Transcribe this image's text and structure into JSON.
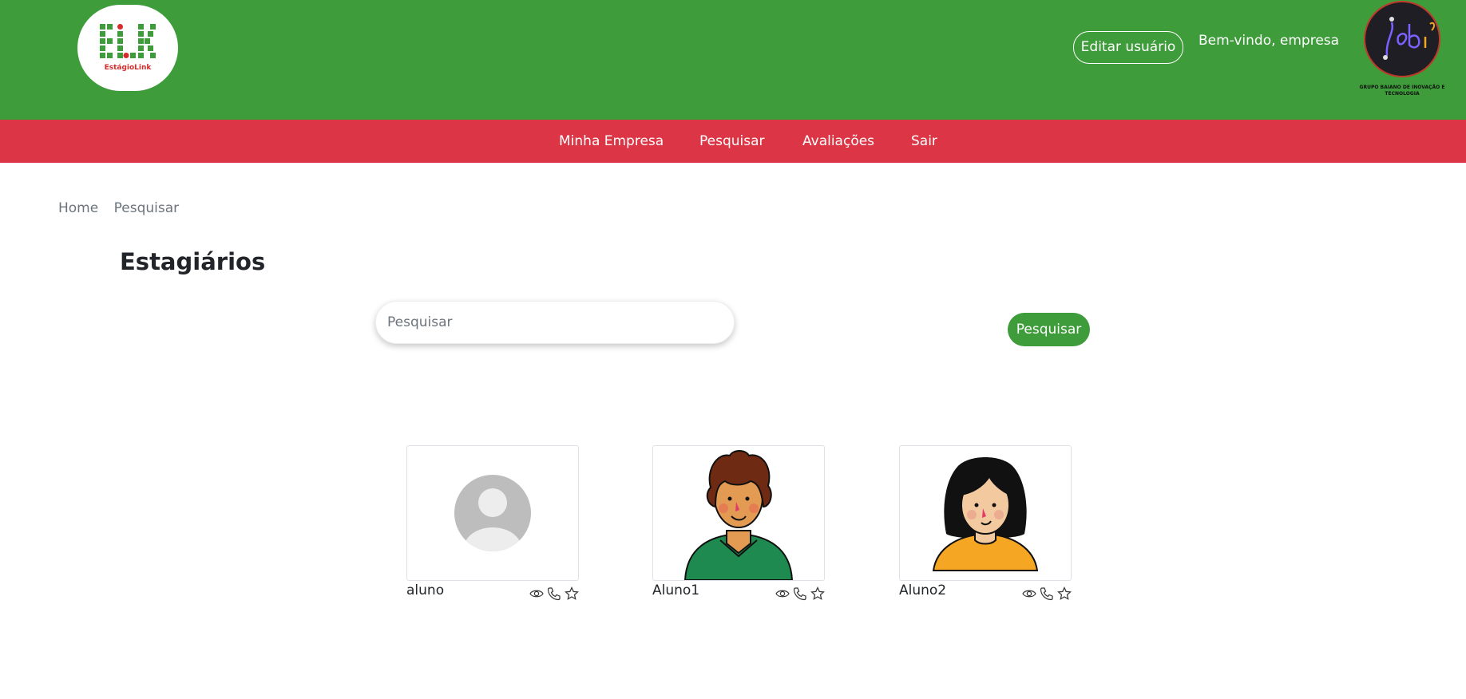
{
  "header": {
    "logo_text": "EstágioLink",
    "edit_user_label": "Editar usuário",
    "welcome_text": "Bem-vindo, empresa",
    "partner_caption": "GRUPO BAIANO DE INOVAÇÃO E TECNOLOGIA"
  },
  "nav": {
    "items": [
      {
        "label": "Minha Empresa"
      },
      {
        "label": "Pesquisar"
      },
      {
        "label": "Avaliações"
      },
      {
        "label": "Sair"
      }
    ]
  },
  "breadcrumb": [
    "Home",
    "Pesquisar"
  ],
  "page_title": "Estagiários",
  "search": {
    "placeholder": "Pesquisar",
    "value": "",
    "button_label": "Pesquisar"
  },
  "interns": [
    {
      "name": "aluno",
      "avatar": "default-avatar-icon"
    },
    {
      "name": "Aluno1",
      "avatar": "curly-hair-boy-avatar"
    },
    {
      "name": "Aluno2",
      "avatar": "black-hair-girl-avatar"
    }
  ],
  "card_actions": [
    "eye-icon",
    "phone-icon",
    "star-icon"
  ],
  "colors": {
    "header_green": "#3e9c3b",
    "nav_red": "#dc3545",
    "logo_red": "#d62b2b"
  }
}
